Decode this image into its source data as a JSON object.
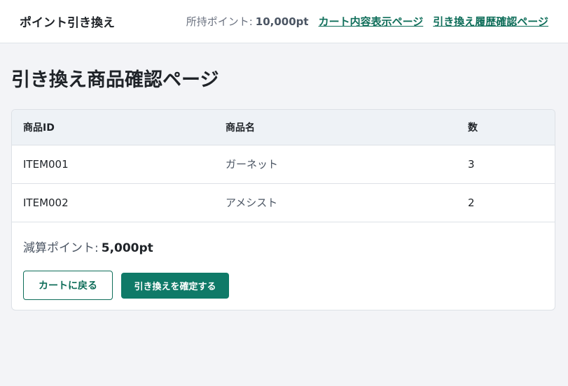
{
  "header": {
    "title": "ポイント引き換え",
    "points_label": "所持ポイント:",
    "points_value": "10,000pt",
    "nav": {
      "cart": "カート内容表示ページ",
      "history": "引き換え履歴確認ページ"
    }
  },
  "main": {
    "page_title": "引き換え商品確認ページ",
    "table": {
      "headers": [
        "商品ID",
        "商品名",
        "数"
      ],
      "rows": [
        {
          "id": "ITEM001",
          "name": "ガーネット",
          "qty": "3"
        },
        {
          "id": "ITEM002",
          "name": "アメシスト",
          "qty": "2"
        }
      ]
    },
    "summary": {
      "label": "減算ポイント:",
      "value": "5,000pt"
    },
    "buttons": {
      "back": "カートに戻る",
      "confirm": "引き換えを確定する"
    }
  },
  "colors": {
    "accent": "#0f7a68",
    "link": "#0f6e5a",
    "background": "#f3f4f7",
    "table_header": "#eef2f6"
  }
}
